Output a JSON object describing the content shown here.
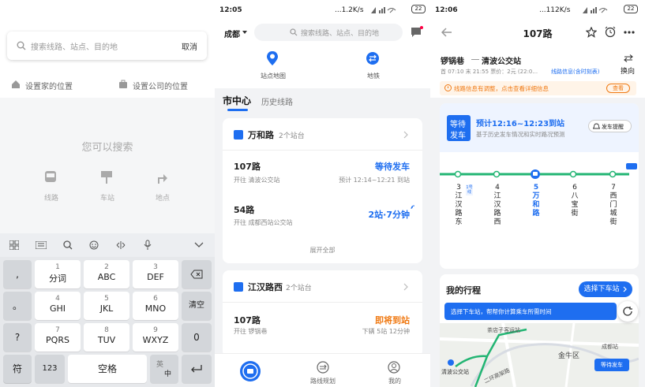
{
  "p1": {
    "search_placeholder": "搜索线路、站点、目的地",
    "cancel": "取消",
    "set_home": "设置家的位置",
    "set_company": "设置公司的位置",
    "empty_hint": "您可以搜索",
    "cat_line": "线路",
    "cat_stop": "车站",
    "cat_place": "地点",
    "keyboard": {
      "left_col": [
        ",",
        "。",
        "?",
        "!"
      ],
      "keys": [
        {
          "num": "1",
          "let": "分词"
        },
        {
          "num": "2",
          "let": "ABC"
        },
        {
          "num": "3",
          "let": "DEF"
        },
        {
          "num": "4",
          "let": "GHI"
        },
        {
          "num": "5",
          "let": "JKL"
        },
        {
          "num": "6",
          "let": "MNO"
        },
        {
          "num": "7",
          "let": "PQRS"
        },
        {
          "num": "8",
          "let": "TUV"
        },
        {
          "num": "9",
          "let": "WXYZ"
        }
      ],
      "clear": "清空",
      "zero": "0",
      "symbol": "符",
      "num_mode": "123",
      "space": "空格",
      "lang_en": "英",
      "lang_zh": "中"
    }
  },
  "p2": {
    "time": "12:05",
    "speed": "...1.2K/s",
    "battery": "22",
    "city": "成都",
    "search_placeholder": "搜索线路、站点、目的地",
    "tool_map": "站点地图",
    "tool_metro": "地铁",
    "tab_active": "市中心",
    "tab_history": "历史线路",
    "stop1": {
      "name": "万和路",
      "count": "2个站台",
      "routes": [
        {
          "no": "107路",
          "dir": "开往 清波公交站",
          "status": "等待发车",
          "note": "预计 12:14~12:21 到站"
        },
        {
          "no": "54路",
          "dir": "开往 成都西站公交站",
          "status": "2站·7分钟",
          "note": ""
        }
      ],
      "expand": "展开全部"
    },
    "stop2": {
      "name": "江汉路西",
      "count": "2个站台",
      "routes": [
        {
          "no": "107路",
          "dir": "开往 锣锅巷",
          "status": "即将到站",
          "note": "下辆 5站 12分钟"
        }
      ]
    },
    "nav_route": "路线规划",
    "nav_mine": "我的"
  },
  "p3": {
    "time": "12:06",
    "speed": "...112K/s",
    "battery": "22",
    "title": "107路",
    "from": "锣锅巷",
    "to": "清波公交站",
    "info": "首 07:10 末 21:55 票价：2元 (22:0...",
    "timetable": "线路信息(含时刻表)",
    "reverse": "换向",
    "notice": "线路信息有调整，点击查看详细信息",
    "notice_btn": "查看",
    "waiting_badge_1": "等待",
    "waiting_badge_2": "发车",
    "eta": "预计12:16~12:23到站",
    "eta_sub": "基于历史发车情况和实时路况预测",
    "remind": "发车提醒",
    "stations": [
      {
        "idx": "3",
        "name": "江汉路东"
      },
      {
        "idx": "4",
        "name": "江汉路西"
      },
      {
        "idx": "5",
        "name": "万和路"
      },
      {
        "idx": "6",
        "name": "八宝街"
      },
      {
        "idx": "7",
        "name": "西门城街"
      }
    ],
    "metro_tag": "1号线",
    "my_trip": "我的行程",
    "select_stop": "选择下车站",
    "select_tip": "选择下车站，帮帮你计算乘车所需时间",
    "map_labels": {
      "a": "茶店子客运站",
      "b": "金牛区",
      "c": "成都站",
      "d": "清波公交站",
      "e": "二环高架路"
    },
    "map_badge": "等待发车"
  }
}
